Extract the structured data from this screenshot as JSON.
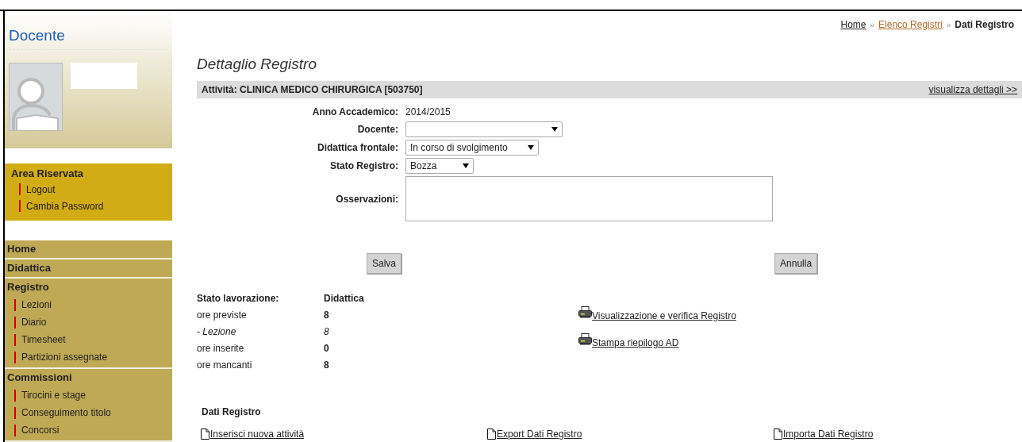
{
  "sidebar": {
    "title": "Docente",
    "area_riservata": {
      "title": "Area Riservata",
      "links": [
        "Logout",
        "Cambia Password"
      ]
    },
    "nav": [
      {
        "label": "Home"
      },
      {
        "label": "Didattica"
      },
      {
        "label": "Registro",
        "children": [
          "Lezioni",
          "Diario",
          "Timesheet",
          "Partizioni assegnate"
        ]
      },
      {
        "label": "Commissioni",
        "children": [
          "Tirocini e stage",
          "Conseguimento titolo",
          "Concorsi"
        ]
      }
    ]
  },
  "breadcrumb": [
    {
      "label": "Home",
      "kind": "link"
    },
    {
      "label": "Elenco Registri",
      "kind": "visited"
    },
    {
      "label": "Dati Registro",
      "kind": "current"
    }
  ],
  "breadcrumb_separator": "»",
  "page_title": "Dettaglio Registro",
  "activity_bar": {
    "label": "Attività: CLINICA MEDICO CHIRURGICA [503750]",
    "link": "visualizza dettagli >>"
  },
  "form": [
    {
      "label": "Anno Accademico:",
      "kind": "text",
      "value": "2014/2015"
    },
    {
      "label": "Docente:",
      "kind": "select"
    },
    {
      "label": "Didattica frontale:",
      "kind": "select",
      "value": "In corso di svolgimento"
    },
    {
      "label": "Stato Registro:",
      "kind": "select",
      "value": "Bozza"
    },
    {
      "label": "Osservazioni:",
      "kind": "textarea"
    }
  ],
  "buttons": [
    "Salva",
    "Annulla"
  ],
  "stats": {
    "header": [
      "Stato lavorazione:",
      "Didattica"
    ],
    "rows": [
      {
        "label": "ore previste",
        "value": "8",
        "italic": false
      },
      {
        "label": "- Lezione",
        "value": "8",
        "italic": true
      },
      {
        "label": "ore inserite",
        "value": "0",
        "italic": false
      },
      {
        "label": "ore mancanti",
        "value": "8",
        "italic": false
      }
    ]
  },
  "print_links": [
    "Visualizzazione e verifica Registro",
    "Stampa riepilogo AD"
  ],
  "dati_registro": {
    "title": "Dati Registro",
    "links": [
      "Inserisci nuova attività",
      "Export Dati Registro",
      "Importa Dati Registro"
    ]
  }
}
